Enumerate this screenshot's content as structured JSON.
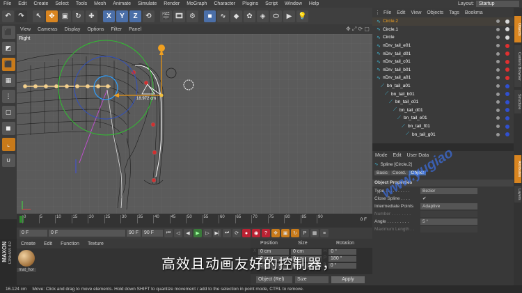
{
  "menubar": {
    "items": [
      "File",
      "Edit",
      "Create",
      "Select",
      "Tools",
      "Mesh",
      "Animate",
      "Simulate",
      "Render",
      "MoGraph",
      "Character",
      "Plugins",
      "Script",
      "Window",
      "Help"
    ],
    "layout_label": "Layout:",
    "layout_value": "Startup"
  },
  "toolbar": {
    "axis_x": "X",
    "axis_y": "Y",
    "axis_z": "Z"
  },
  "viewport": {
    "menu": [
      "View",
      "Cameras",
      "Display",
      "Options",
      "Filter",
      "Panel"
    ],
    "label": "Right",
    "measure": "18.972 cm"
  },
  "timeline": {
    "ticks": [
      "0",
      "5",
      "10",
      "15",
      "20",
      "25",
      "30",
      "35",
      "40",
      "45",
      "50",
      "55",
      "60",
      "65",
      "70",
      "75",
      "80",
      "85",
      "90"
    ],
    "end_frame": "0 F"
  },
  "transport": {
    "start_frame": "0 F",
    "current_frame": "0 F",
    "end_field": "90 F",
    "end_field2": "90 F"
  },
  "material": {
    "menu": [
      "Create",
      "Edit",
      "Function",
      "Texture"
    ],
    "name": "mat_hor"
  },
  "coords": {
    "headers": [
      "Position",
      "Size",
      "Rotation"
    ],
    "rows": [
      {
        "axis": "X",
        "pos": "0 cm",
        "size": "0 cm",
        "rot_axis": "H",
        "rot": "0 °"
      },
      {
        "axis": "Y",
        "pos": "0 cm",
        "size": "0 cm",
        "rot_axis": "P",
        "rot": "180 °"
      },
      {
        "axis": "Z",
        "pos": "0 cm",
        "size": "0 cm",
        "rot_axis": "B",
        "rot": "0 °"
      }
    ],
    "mode": "Object (Rel)",
    "size_mode": "Size",
    "apply": "Apply"
  },
  "objects": {
    "menu": [
      "File",
      "Edit",
      "View",
      "Objects",
      "Tags",
      "Bookma"
    ],
    "items": [
      {
        "name": "Circle.2",
        "indent": 0,
        "color": "#f0a020",
        "tag": "#d8d8d8"
      },
      {
        "name": "Circle.1",
        "indent": 0,
        "color": "#ffffff",
        "tag": "#d8d8d8"
      },
      {
        "name": "Circle",
        "indent": 0,
        "color": "#ffffff",
        "tag": "#d8d8d8"
      },
      {
        "name": "nDrv_tail_e01",
        "indent": 0,
        "color": "#ffffff",
        "tag": "#e03030"
      },
      {
        "name": "nDrv_tail_d01",
        "indent": 0,
        "color": "#ffffff",
        "tag": "#e03030"
      },
      {
        "name": "nDrv_tail_c01",
        "indent": 0,
        "color": "#ffffff",
        "tag": "#e03030"
      },
      {
        "name": "nDrv_tail_b01",
        "indent": 0,
        "color": "#ffffff",
        "tag": "#e03030"
      },
      {
        "name": "nDrv_tail_a01",
        "indent": 0,
        "color": "#ffffff",
        "tag": "#e03030"
      },
      {
        "name": "bn_tail_a01",
        "indent": 1,
        "color": "#ffffff",
        "tag": "#3050d0"
      },
      {
        "name": "bn_tail_b01",
        "indent": 2,
        "color": "#ffffff",
        "tag": "#3050d0"
      },
      {
        "name": "bn_tail_c01",
        "indent": 3,
        "color": "#ffffff",
        "tag": "#3050d0"
      },
      {
        "name": "bn_tail_d01",
        "indent": 4,
        "color": "#ffffff",
        "tag": "#3050d0"
      },
      {
        "name": "bn_tail_e01",
        "indent": 5,
        "color": "#ffffff",
        "tag": "#3050d0"
      },
      {
        "name": "bn_tail_f01",
        "indent": 6,
        "color": "#ffffff",
        "tag": "#3050d0"
      },
      {
        "name": "bn_tail_g01",
        "indent": 7,
        "color": "#ffffff",
        "tag": "#3050d0"
      }
    ]
  },
  "attributes": {
    "menu": [
      "Mode",
      "Edit",
      "User Data"
    ],
    "title": "Spline [Circle.2]",
    "tabs": [
      "Basic",
      "Coord.",
      "Object"
    ],
    "section": "Object Properties",
    "fields": [
      {
        "label": "Type . . . . . . . . . .",
        "value": "Bezier"
      },
      {
        "label": "Close Spline . . . .",
        "value": "✔"
      },
      {
        "label": "Intermediate Points",
        "value": "Adaptive"
      },
      {
        "label": "Number . . . . . . . .",
        "value": ""
      },
      {
        "label": "Angle . . . . . . . . .",
        "value": "5 °"
      },
      {
        "label": "Maximum Length . .",
        "value": ""
      }
    ]
  },
  "right_tabs": [
    "Objects",
    "Content Browser",
    "Structure",
    "Attributes",
    "Layers"
  ],
  "status": {
    "value": "16.124 cm",
    "message": "Move: Click and drag to move elements. Hold down SHIFT to quantize movement / add to the selection in point mode, CTRL to remove."
  },
  "overlay": {
    "subtitle": "高效且动画友好的控制器，",
    "watermark": "www.yugiao"
  },
  "brand": {
    "maxon": "MAXON",
    "c4d": "CINEMA 4D"
  }
}
